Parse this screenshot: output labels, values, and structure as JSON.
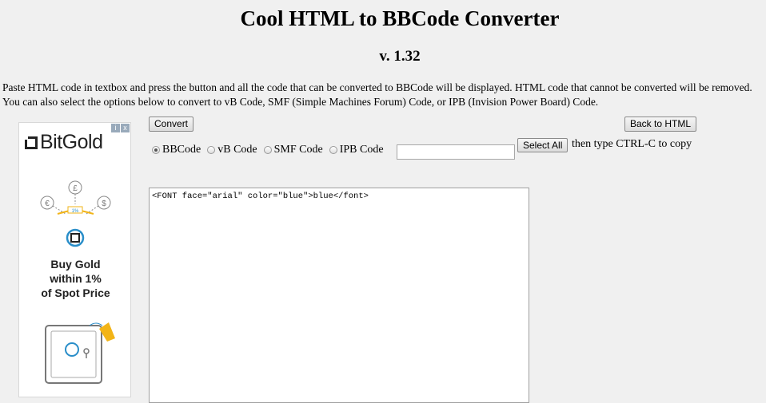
{
  "header": {
    "title": "Cool HTML to BBCode Converter",
    "version": "v. 1.32"
  },
  "intro_text": "Paste HTML code in textbox and press the button and all the code that can be converted to BBCode will be displayed. HTML code that cannot be converted will be removed. You can also select the options below to convert to vB Code, SMF (Simple Machines Forum) Code, or IPB (Invision Power Board) Code.",
  "toolbar": {
    "convert_label": "Convert",
    "back_label": "Back to HTML",
    "select_all_label": "Select All",
    "copy_hint": "then type CTRL-C to copy",
    "copy_field_value": ""
  },
  "options": [
    {
      "label": "BBCode",
      "checked": true
    },
    {
      "label": "vB Code",
      "checked": false
    },
    {
      "label": "SMF Code",
      "checked": false
    },
    {
      "label": "IPB Code",
      "checked": false
    }
  ],
  "editor": {
    "content": "<FONT face=\"arial\" color=\"blue\">blue</font>"
  },
  "ad": {
    "brand": "BitGold",
    "tagline_1": "Buy Gold",
    "tagline_2": "within 1%",
    "tagline_3": "of Spot Price",
    "choices_info": "i",
    "choices_close": "x",
    "coin_pound": "£",
    "coin_euro": "€",
    "coin_dollar": "$",
    "pct_badge": "1%",
    "colors": {
      "brand": "#222222",
      "accent": "#f2b417",
      "icon_blue": "#2a8ec9"
    }
  }
}
